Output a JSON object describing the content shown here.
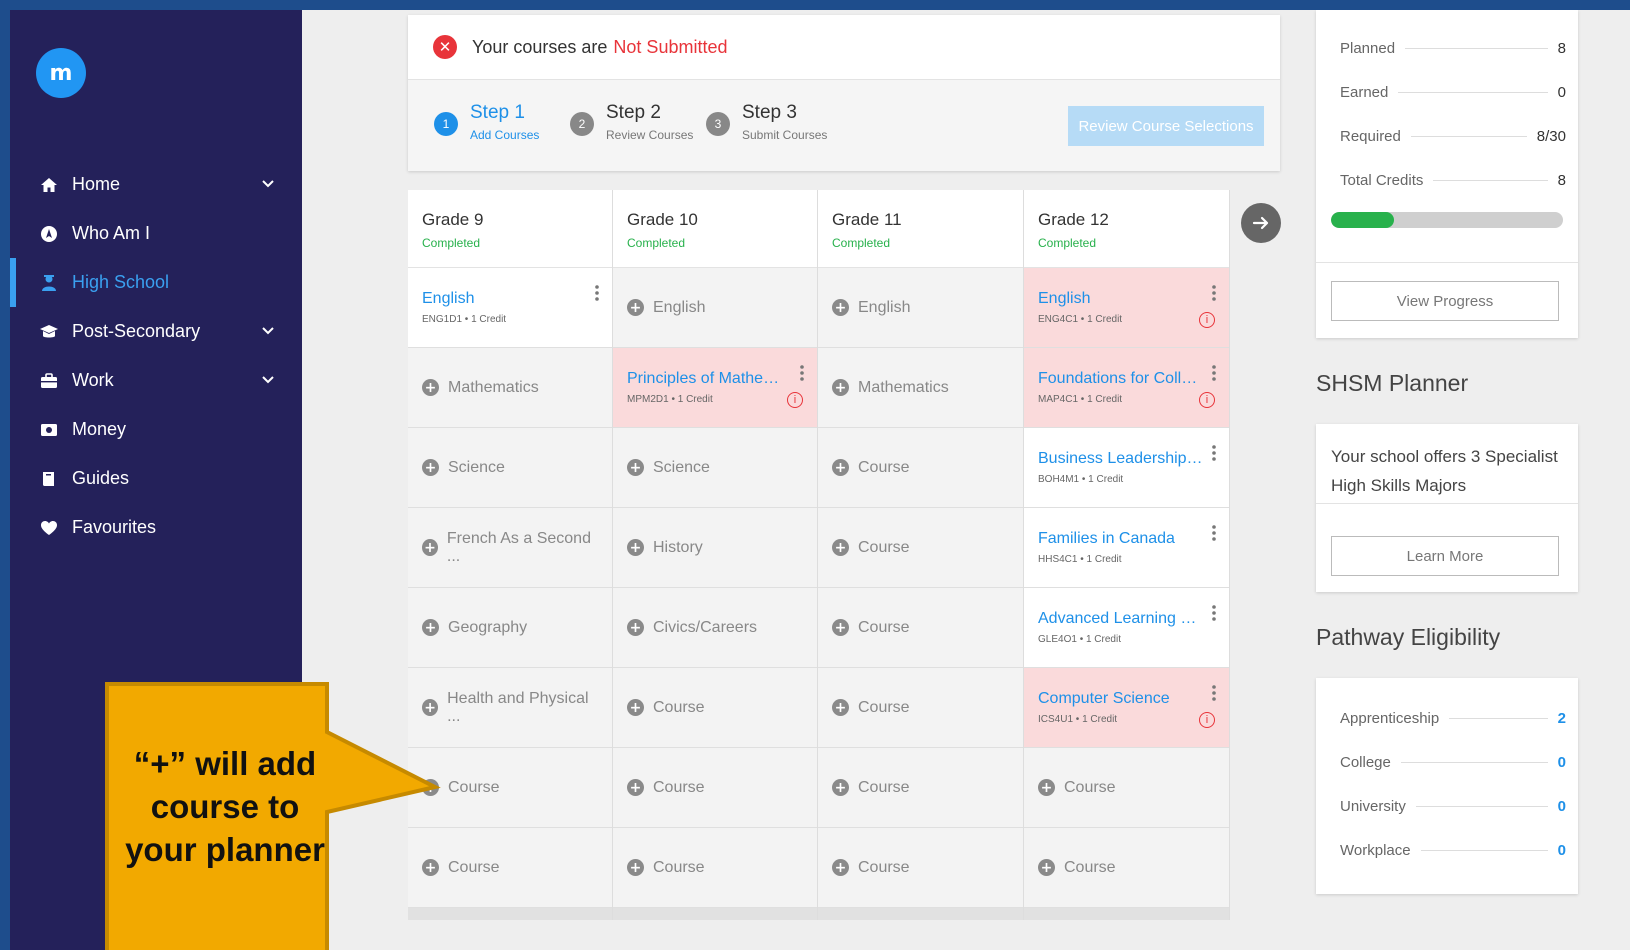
{
  "sidebar": {
    "logo_letter": "m",
    "items": [
      {
        "label": "Home",
        "icon": "home-icon",
        "chevron": true
      },
      {
        "label": "Who Am I",
        "icon": "compass-icon",
        "chevron": false
      },
      {
        "label": "High School",
        "icon": "student-icon",
        "chevron": false,
        "active": true
      },
      {
        "label": "Post-Secondary",
        "icon": "graduation-cap-icon",
        "chevron": true
      },
      {
        "label": "Work",
        "icon": "briefcase-icon",
        "chevron": true
      },
      {
        "label": "Money",
        "icon": "money-icon",
        "chevron": false
      },
      {
        "label": "Guides",
        "icon": "book-icon",
        "chevron": false
      },
      {
        "label": "Favourites",
        "icon": "heart-icon",
        "chevron": false
      }
    ]
  },
  "status": {
    "prefix": "Your courses are",
    "state": "Not Submitted"
  },
  "steps": [
    {
      "num": "1",
      "title": "Step 1",
      "sub": "Add Courses",
      "active": true
    },
    {
      "num": "2",
      "title": "Step 2",
      "sub": "Review Courses",
      "active": false
    },
    {
      "num": "3",
      "title": "Step 3",
      "sub": "Submit Courses",
      "active": false
    }
  ],
  "review_button": "Review Course Selections",
  "grades": [
    {
      "title": "Grade 9",
      "status": "Completed",
      "cells": [
        {
          "type": "filled",
          "name": "English",
          "code": "ENG1D1 • 1 Credit"
        },
        {
          "type": "empty",
          "label": "Mathematics"
        },
        {
          "type": "empty",
          "label": "Science"
        },
        {
          "type": "empty",
          "label": "French As a Second ..."
        },
        {
          "type": "empty",
          "label": "Geography"
        },
        {
          "type": "empty",
          "label": "Health and Physical ..."
        },
        {
          "type": "empty",
          "label": "Course"
        },
        {
          "type": "empty",
          "label": "Course"
        }
      ]
    },
    {
      "title": "Grade 10",
      "status": "Completed",
      "cells": [
        {
          "type": "empty",
          "label": "English"
        },
        {
          "type": "filled",
          "warn": true,
          "name": "Principles of Mathema...",
          "code": "MPM2D1 • 1 Credit"
        },
        {
          "type": "empty",
          "label": "Science"
        },
        {
          "type": "empty",
          "label": "History"
        },
        {
          "type": "empty",
          "label": "Civics/Careers"
        },
        {
          "type": "empty",
          "label": "Course"
        },
        {
          "type": "empty",
          "label": "Course"
        },
        {
          "type": "empty",
          "label": "Course"
        }
      ]
    },
    {
      "title": "Grade 11",
      "status": "Completed",
      "cells": [
        {
          "type": "empty",
          "label": "English"
        },
        {
          "type": "empty",
          "label": "Mathematics"
        },
        {
          "type": "empty",
          "label": "Course"
        },
        {
          "type": "empty",
          "label": "Course"
        },
        {
          "type": "empty",
          "label": "Course"
        },
        {
          "type": "empty",
          "label": "Course"
        },
        {
          "type": "empty",
          "label": "Course"
        },
        {
          "type": "empty",
          "label": "Course"
        }
      ]
    },
    {
      "title": "Grade 12",
      "status": "Completed",
      "cells": [
        {
          "type": "filled",
          "warn": true,
          "name": "English",
          "code": "ENG4C1 • 1 Credit"
        },
        {
          "type": "filled",
          "warn": true,
          "name": "Foundations for Colleg...",
          "code": "MAP4C1 • 1 Credit"
        },
        {
          "type": "filled",
          "name": "Business Leadership: ...",
          "code": "BOH4M1 • 1 Credit"
        },
        {
          "type": "filled",
          "name": "Families in Canada",
          "code": "HHS4C1 • 1 Credit"
        },
        {
          "type": "filled",
          "name": "Advanced Learning Str...",
          "code": "GLE4O1 • 1 Credit"
        },
        {
          "type": "filled",
          "warn": true,
          "name": "Computer Science",
          "code": "ICS4U1 • 1 Credit"
        },
        {
          "type": "empty",
          "label": "Course"
        },
        {
          "type": "empty",
          "label": "Course"
        }
      ]
    }
  ],
  "credits": {
    "rows": [
      {
        "label": "Planned",
        "value": "8"
      },
      {
        "label": "Earned",
        "value": "0"
      },
      {
        "label": "Required",
        "value": "8/30"
      },
      {
        "label": "Total Credits",
        "value": "8"
      }
    ],
    "progress_fraction": 0.27,
    "button": "View Progress"
  },
  "shsm": {
    "title": "SHSM Planner",
    "text": "Your school offers 3 Specialist High Skills Majors",
    "button": "Learn More"
  },
  "pathway": {
    "title": "Pathway Eligibility",
    "rows": [
      {
        "label": "Apprenticeship",
        "value": "2"
      },
      {
        "label": "College",
        "value": "0"
      },
      {
        "label": "University",
        "value": "0"
      },
      {
        "label": "Workplace",
        "value": "0"
      }
    ]
  },
  "callout": {
    "text": "“+” will add course to your planner"
  },
  "colors": {
    "sidebar_bg": "#24215a",
    "accent": "#1e90e8",
    "error": "#e8343a",
    "success": "#28b14c",
    "warn_bg": "#fadadb",
    "callout_fill": "#f2a900"
  }
}
